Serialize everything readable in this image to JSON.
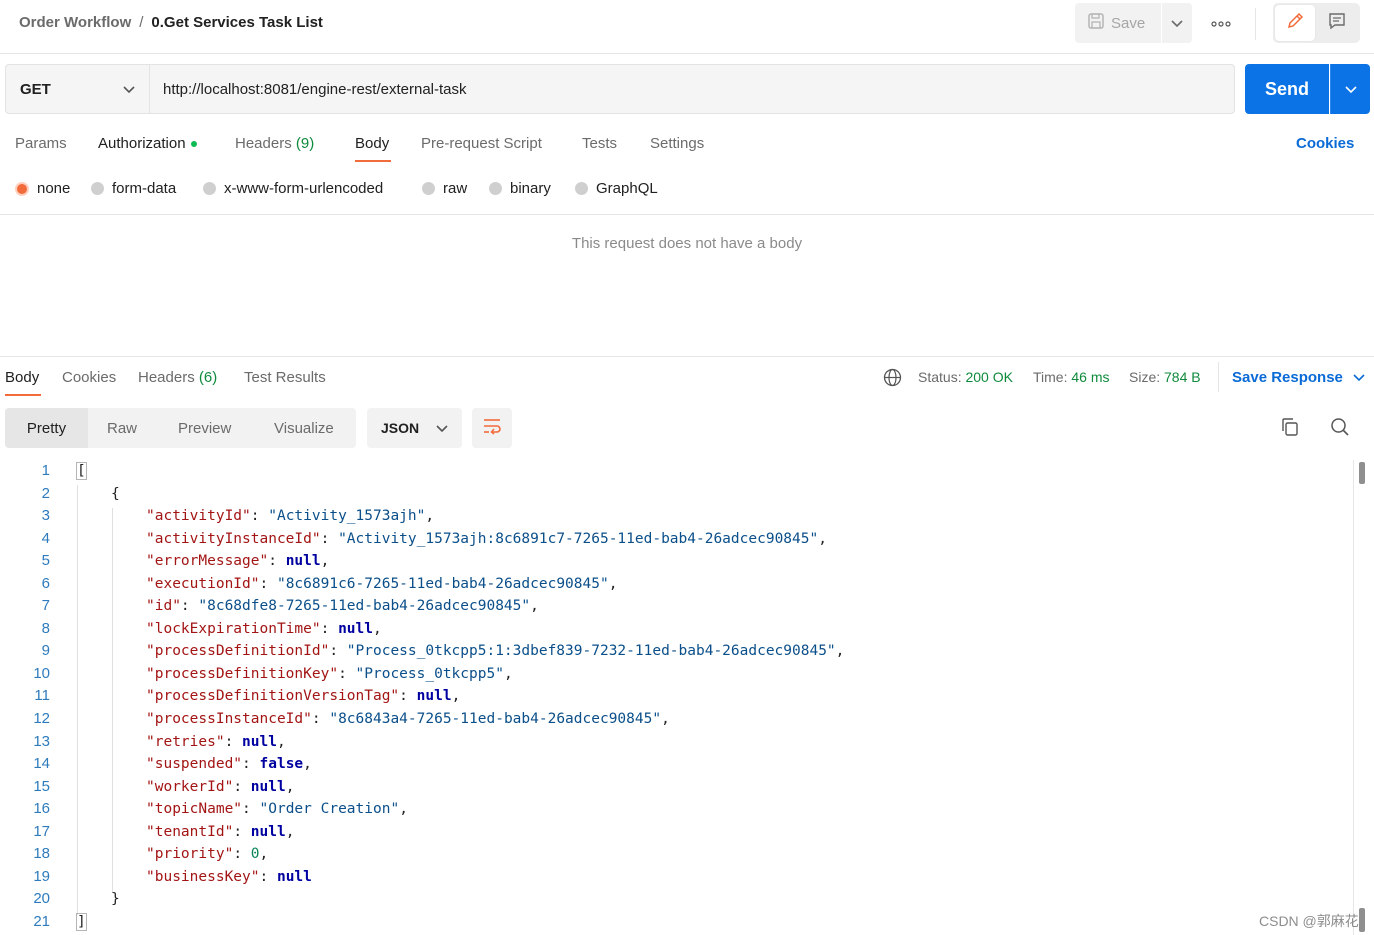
{
  "header": {
    "collection": "Order Workflow",
    "separator": "/",
    "request_name": "0.Get Services Task List",
    "save_label": "Save",
    "more_icon": "more-horizontal-icon",
    "edit_icon": "pencil-icon",
    "comment_icon": "comment-icon"
  },
  "request": {
    "method": "GET",
    "url": "http://localhost:8081/engine-rest/external-task",
    "send_label": "Send"
  },
  "tabs": {
    "params": "Params",
    "authorization": "Authorization",
    "headers": "Headers",
    "headers_count": "(9)",
    "body": "Body",
    "prerequest": "Pre-request Script",
    "tests": "Tests",
    "settings": "Settings",
    "cookies": "Cookies"
  },
  "body_modes": {
    "none": "none",
    "form_data": "form-data",
    "urlencoded": "x-www-form-urlencoded",
    "raw": "raw",
    "binary": "binary",
    "graphql": "GraphQL",
    "selected": "none"
  },
  "empty_body_message": "This request does not have a body",
  "response": {
    "tabs": {
      "body": "Body",
      "cookies": "Cookies",
      "headers": "Headers",
      "headers_count": "(6)",
      "test_results": "Test Results"
    },
    "status_label": "Status:",
    "status_value": "200 OK",
    "time_label": "Time:",
    "time_value": "46 ms",
    "size_label": "Size:",
    "size_value": "784 B",
    "save_response": "Save Response",
    "views": {
      "pretty": "Pretty",
      "raw": "Raw",
      "preview": "Preview",
      "visualize": "Visualize"
    },
    "format": "JSON"
  },
  "code": {
    "line_numbers": [
      "1",
      "2",
      "3",
      "4",
      "5",
      "6",
      "7",
      "8",
      "9",
      "10",
      "11",
      "12",
      "13",
      "14",
      "15",
      "16",
      "17",
      "18",
      "19",
      "20",
      "21"
    ],
    "open_bracket": "[",
    "open_brace": "{",
    "close_brace": "}",
    "close_bracket": "]",
    "fields": [
      {
        "key": "\"activityId\"",
        "value": "\"Activity_1573ajh\"",
        "type": "s",
        "comma": ","
      },
      {
        "key": "\"activityInstanceId\"",
        "value": "\"Activity_1573ajh:8c6891c7-7265-11ed-bab4-26adcec90845\"",
        "type": "s",
        "comma": ","
      },
      {
        "key": "\"errorMessage\"",
        "value": "null",
        "type": "n",
        "comma": ","
      },
      {
        "key": "\"executionId\"",
        "value": "\"8c6891c6-7265-11ed-bab4-26adcec90845\"",
        "type": "s",
        "comma": ","
      },
      {
        "key": "\"id\"",
        "value": "\"8c68dfe8-7265-11ed-bab4-26adcec90845\"",
        "type": "s",
        "comma": ","
      },
      {
        "key": "\"lockExpirationTime\"",
        "value": "null",
        "type": "n",
        "comma": ","
      },
      {
        "key": "\"processDefinitionId\"",
        "value": "\"Process_0tkcpp5:1:3dbef839-7232-11ed-bab4-26adcec90845\"",
        "type": "s",
        "comma": ","
      },
      {
        "key": "\"processDefinitionKey\"",
        "value": "\"Process_0tkcpp5\"",
        "type": "s",
        "comma": ","
      },
      {
        "key": "\"processDefinitionVersionTag\"",
        "value": "null",
        "type": "n",
        "comma": ","
      },
      {
        "key": "\"processInstanceId\"",
        "value": "\"8c6843a4-7265-11ed-bab4-26adcec90845\"",
        "type": "s",
        "comma": ","
      },
      {
        "key": "\"retries\"",
        "value": "null",
        "type": "n",
        "comma": ","
      },
      {
        "key": "\"suspended\"",
        "value": "false",
        "type": "n",
        "comma": ","
      },
      {
        "key": "\"workerId\"",
        "value": "null",
        "type": "n",
        "comma": ","
      },
      {
        "key": "\"topicName\"",
        "value": "\"Order Creation\"",
        "type": "s",
        "comma": ","
      },
      {
        "key": "\"tenantId\"",
        "value": "null",
        "type": "n",
        "comma": ","
      },
      {
        "key": "\"priority\"",
        "value": "0",
        "type": "num",
        "comma": ","
      },
      {
        "key": "\"businessKey\"",
        "value": "null",
        "type": "n",
        "comma": ""
      }
    ]
  },
  "watermark": "CSDN @郭麻花",
  "colors": {
    "accent": "#f26b3a",
    "send": "#0b73e6",
    "link": "#0b6bd6",
    "status_ok": "#0f8a3c"
  }
}
